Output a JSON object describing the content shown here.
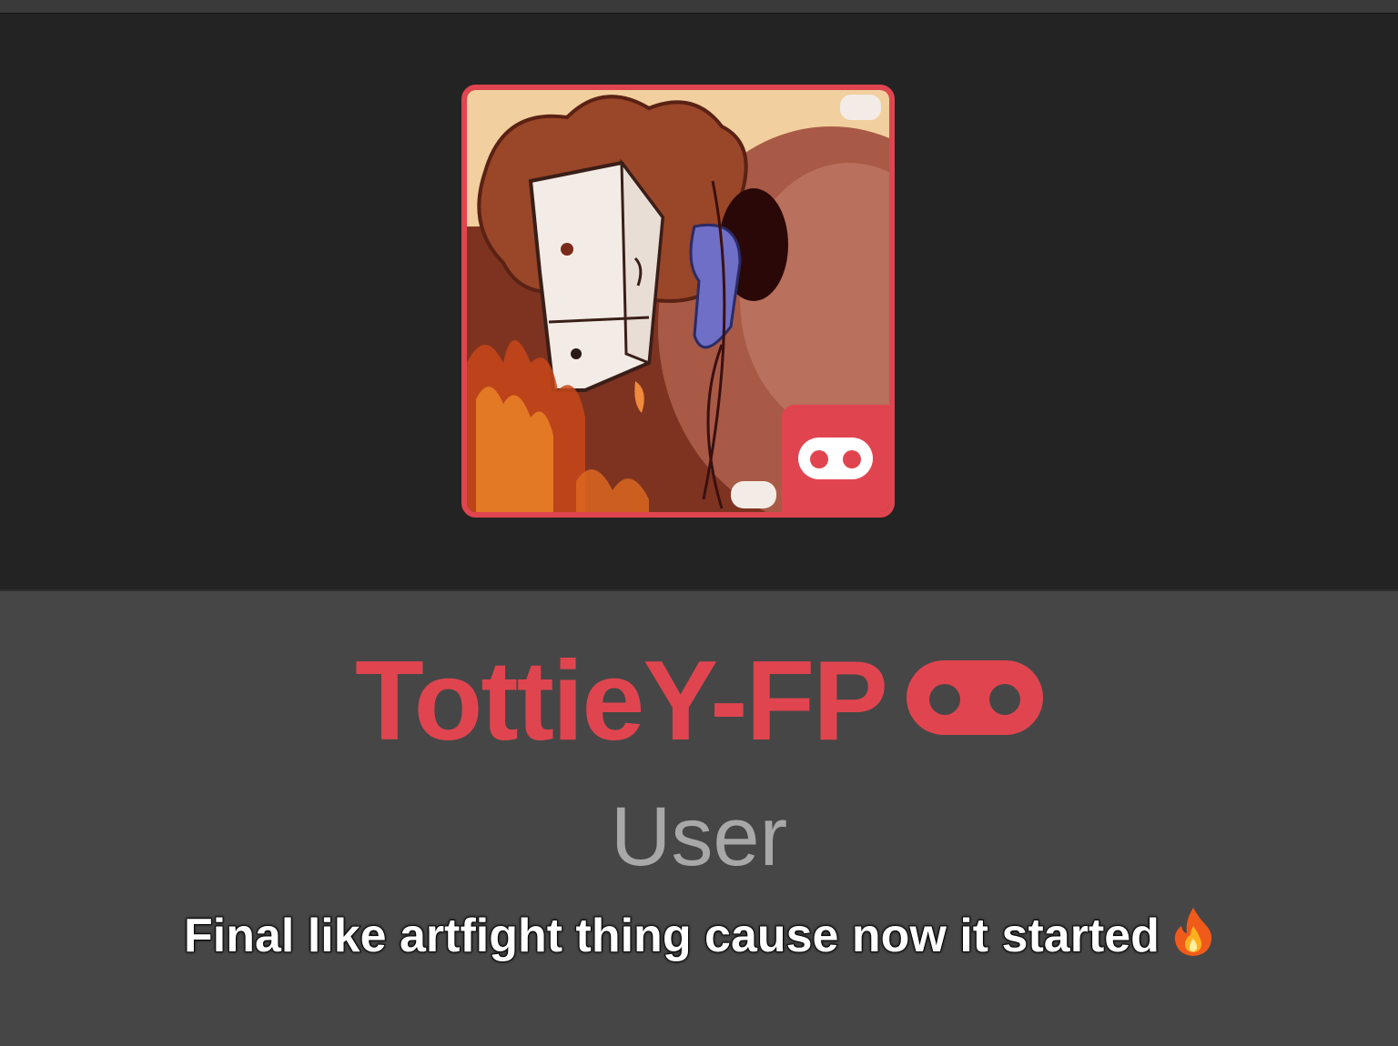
{
  "profile": {
    "username": "TottieY-FP",
    "role": "User",
    "badge_icon": "mask-icon",
    "accent_color": "#e0454f"
  },
  "caption": {
    "text": "Final like artfight thing cause now it started",
    "emoji_icon": "fire-emoji-icon"
  }
}
